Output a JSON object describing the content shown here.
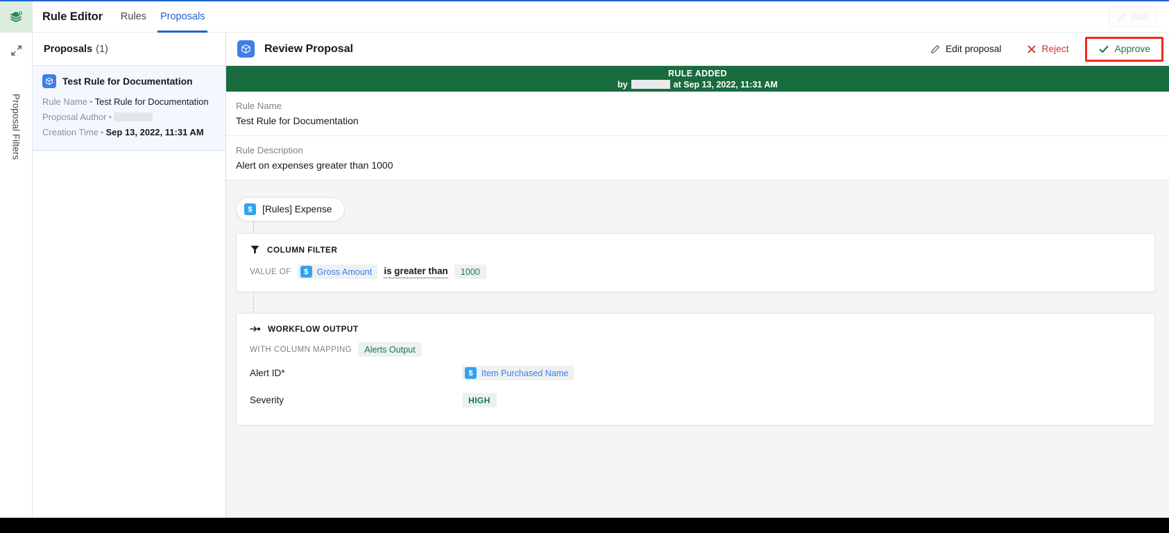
{
  "window": {
    "accent_blue": "#1c64d1",
    "banner_green": "#196c3e",
    "highlight_red": "#f5291c"
  },
  "rail": {
    "logo_icon": "stacked-layers-logo",
    "expand_icon": "expand-diagonal-icon",
    "vertical_label": "Proposal Filters"
  },
  "header": {
    "app_title": "Rule Editor",
    "tabs": [
      {
        "label": "Rules",
        "active": false
      },
      {
        "label": "Proposals",
        "active": true
      }
    ],
    "edit_button": {
      "label": "Edit",
      "icon": "pencil-icon",
      "disabled": true
    }
  },
  "sidebar": {
    "title": "Proposals",
    "count": "(1)",
    "items": [
      {
        "icon": "cube-icon",
        "title": "Test Rule for Documentation",
        "fields": [
          {
            "key": "Rule Name",
            "value": "Test Rule for Documentation",
            "redacted": false
          },
          {
            "key": "Proposal Author",
            "value": "",
            "redacted": true
          },
          {
            "key": "Creation Time",
            "value": "Sep 13, 2022, 11:31 AM",
            "redacted": false
          }
        ]
      }
    ]
  },
  "main": {
    "icon": "cube-icon",
    "title": "Review Proposal",
    "actions": {
      "edit_proposal": {
        "label": "Edit proposal",
        "icon": "pencil-icon"
      },
      "reject": {
        "label": "Reject",
        "icon": "close-x-icon"
      },
      "approve": {
        "label": "Approve",
        "icon": "check-icon",
        "highlighted": true
      }
    },
    "banner": {
      "line1": "RULE ADDED",
      "by_prefix": "by",
      "author_redacted": true,
      "at_text": "at Sep 13, 2022, 11:31 AM"
    },
    "fields": [
      {
        "label": "Rule Name",
        "value": "Test Rule for Documentation"
      },
      {
        "label": "Rule Description",
        "value": "Alert on expenses greater than 1000"
      }
    ],
    "source_chip": {
      "icon": "dollar-dataset-icon",
      "label": "[Rules] Expense"
    },
    "column_filter": {
      "icon": "funnel-icon",
      "heading": "COLUMN FILTER",
      "prefix": "VALUE OF",
      "column": {
        "icon": "dollar-column-icon",
        "name": "Gross Amount"
      },
      "operator": "is greater than",
      "value": "1000"
    },
    "workflow_output": {
      "icon": "arrow-to-dot-icon",
      "heading": "WORKFLOW OUTPUT",
      "mapping_prefix": "WITH COLUMN MAPPING",
      "mapping_target": "Alerts Output",
      "rows": [
        {
          "key": "Alert ID*",
          "value": "Item Purchased Name",
          "type": "column",
          "icon": "dollar-column-icon"
        },
        {
          "key": "Severity",
          "value": "HIGH",
          "type": "literal"
        }
      ]
    }
  }
}
